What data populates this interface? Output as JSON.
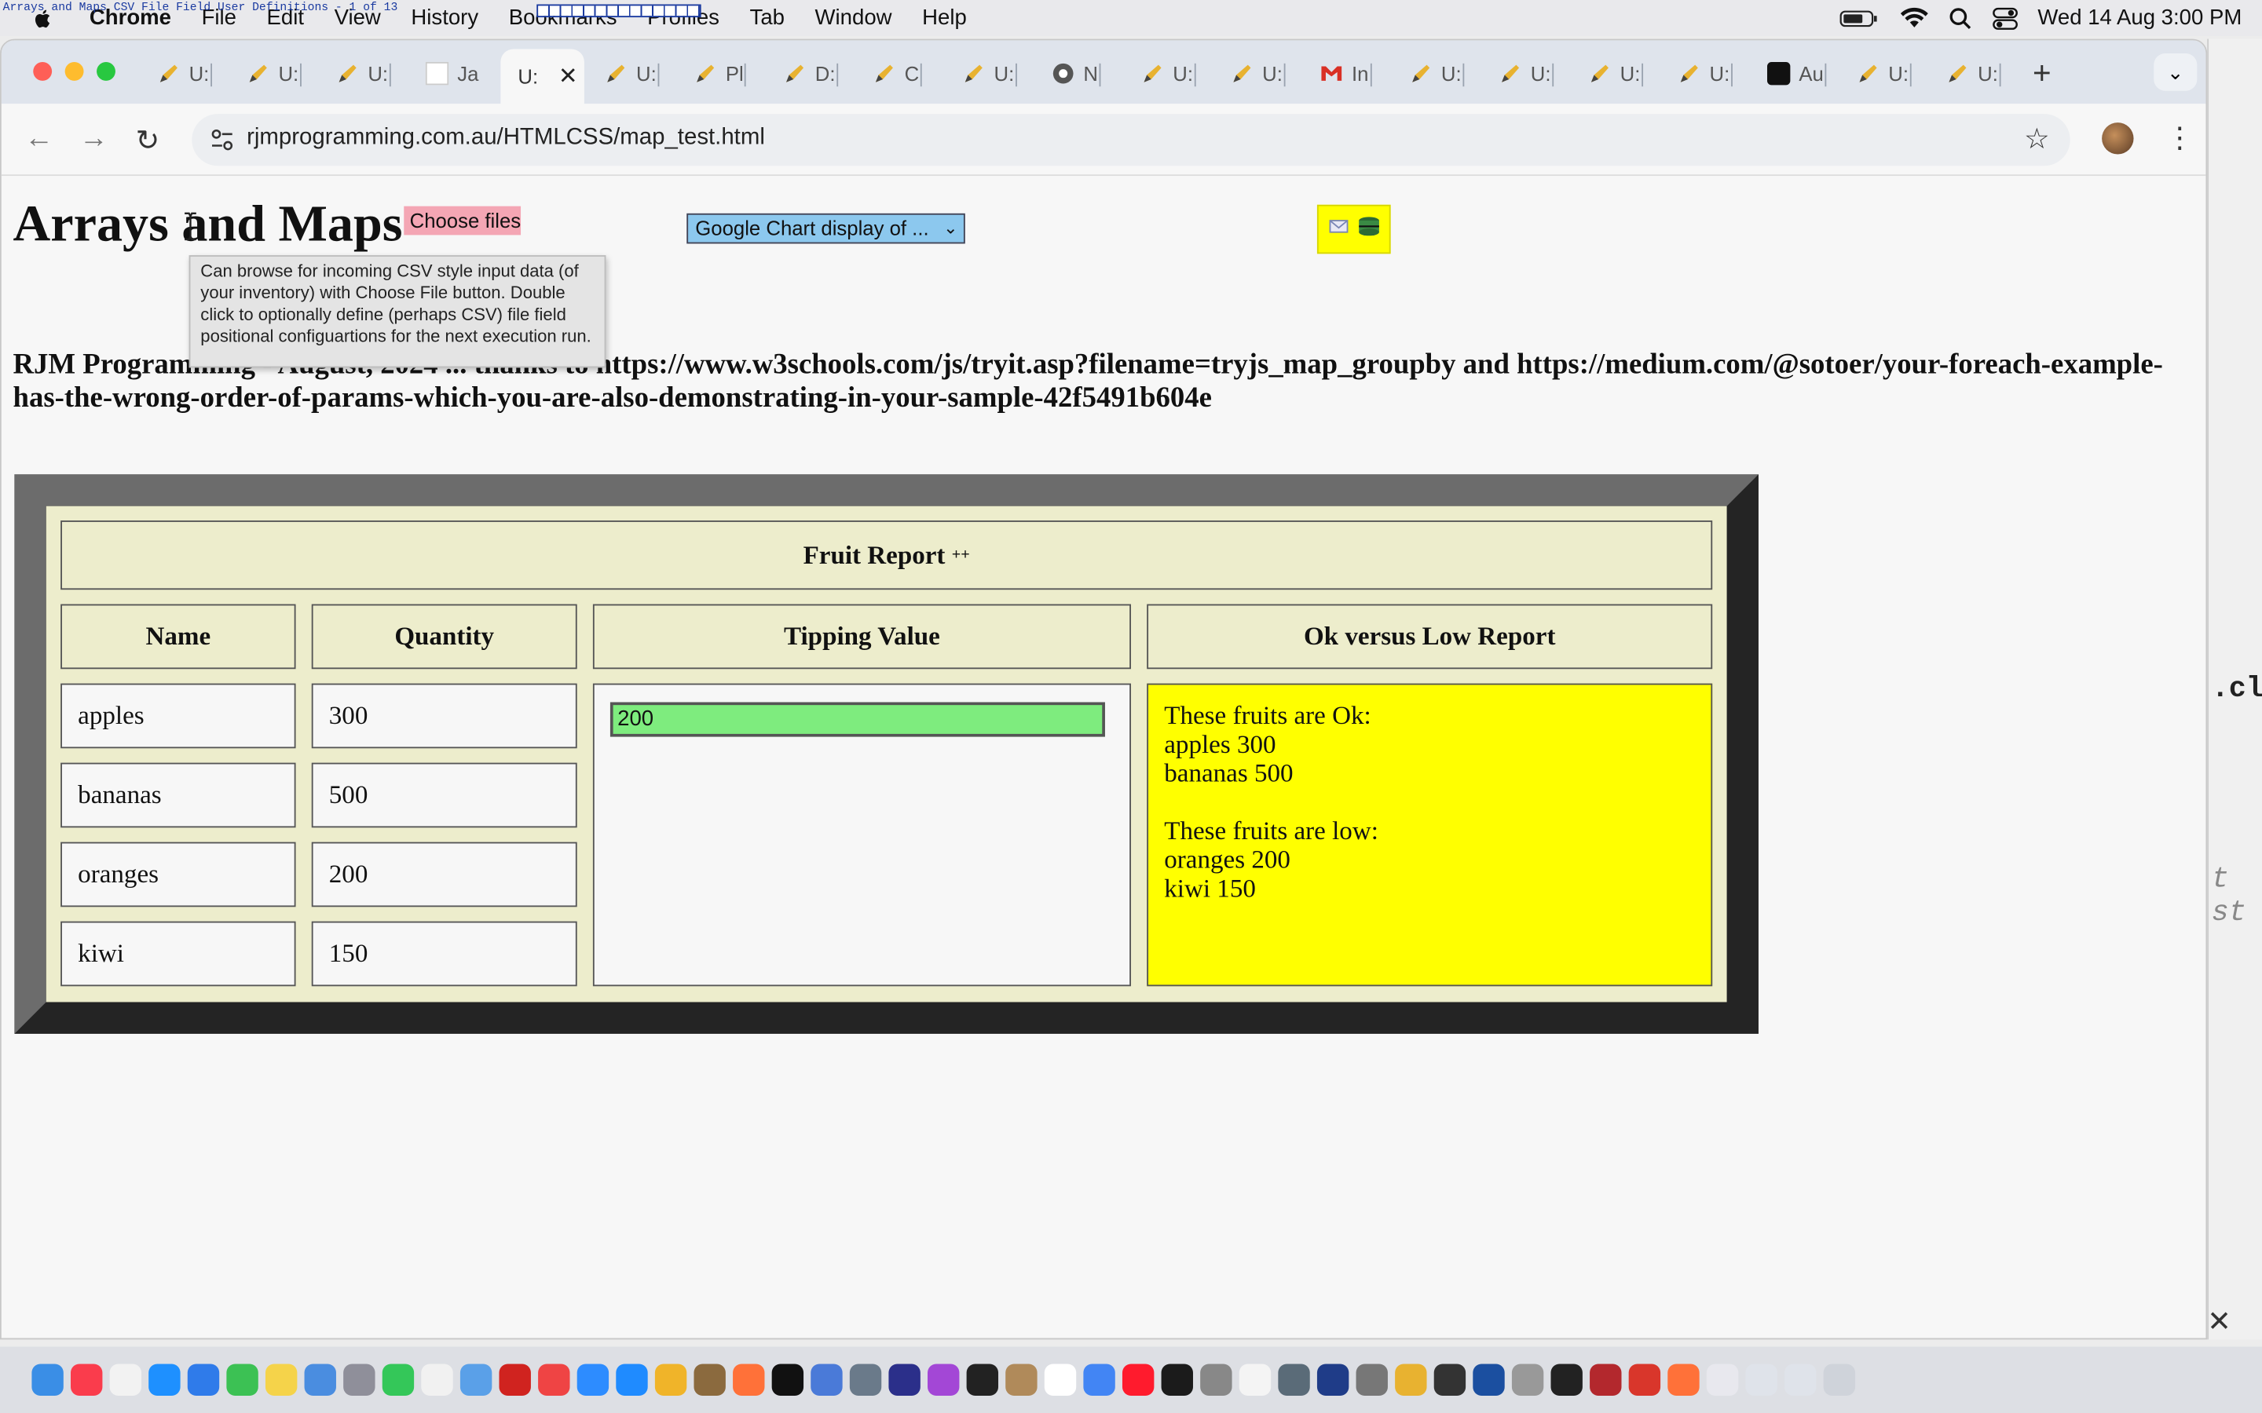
{
  "menubar": {
    "items": [
      "Chrome",
      "File",
      "Edit",
      "View",
      "History",
      "Bookmarks",
      "Profiles",
      "Tab",
      "Window",
      "Help"
    ],
    "datetime": "Wed 14 Aug  3:00 PM",
    "tiny_title": "Arrays and Maps CSV File Field User Definitions - 1 of 13"
  },
  "tabs": [
    {
      "label": "U:"
    },
    {
      "label": "U:"
    },
    {
      "label": "U:"
    },
    {
      "label": "Ja"
    },
    {
      "label": "U:"
    },
    {
      "label": "Pl"
    },
    {
      "label": "D:"
    },
    {
      "label": "C"
    },
    {
      "label": "U:"
    },
    {
      "label": "N"
    },
    {
      "label": "U:"
    },
    {
      "label": "U:"
    },
    {
      "label": "In"
    },
    {
      "label": "U:"
    },
    {
      "label": "U:"
    },
    {
      "label": "U:"
    },
    {
      "label": "U:"
    },
    {
      "label": "Au"
    },
    {
      "label": "U:"
    },
    {
      "label": "U:"
    }
  ],
  "active_tab": {
    "label": "U:"
  },
  "address_bar": {
    "url": "rjmprogramming.com.au/HTMLCSS/map_test.html"
  },
  "page": {
    "heading": "Arrays and Maps",
    "file_button": "Choose files",
    "chart_select": "Google Chart display of ...",
    "tooltip": "Can browse for incoming CSV style input data (of your inventory) with Choose File button. Double click to optionally define (perhaps CSV) file field positional configuartions for the next execution run.",
    "credit": "RJM Programming - August, 2024 ... thanks to https://www.w3schools.com/js/tryit.asp?filename=tryjs_map_groupby and https://medium.com/@sotoer/your-foreach-example-has-the-wrong-order-of-params-which-you-are-also-demonstrating-in-your-sample-42f5491b604e"
  },
  "report": {
    "title": "Fruit Report",
    "title_sup": "++",
    "columns": [
      "Name",
      "Quantity",
      "Tipping Value",
      "Ok versus Low Report"
    ],
    "rows": [
      {
        "name": "apples",
        "quantity": "300"
      },
      {
        "name": "bananas",
        "quantity": "500"
      },
      {
        "name": "oranges",
        "quantity": "200"
      },
      {
        "name": "kiwi",
        "quantity": "150"
      }
    ],
    "tipping_value": "200",
    "ok_heading": "These fruits are Ok:",
    "ok_items": [
      "apples 300",
      "bananas 500"
    ],
    "low_heading": "These fruits are low:",
    "low_items": [
      "oranges 200",
      "kiwi 150"
    ]
  },
  "side_window": {
    "text1": ".cl",
    "text2": "t st"
  },
  "colors": {
    "tip_input": "#7eec7e",
    "report_bg": "#ffff00",
    "file_button": "#f4a6b4",
    "chart_select": "#8cc8ee",
    "table_bg": "#ededcc"
  }
}
